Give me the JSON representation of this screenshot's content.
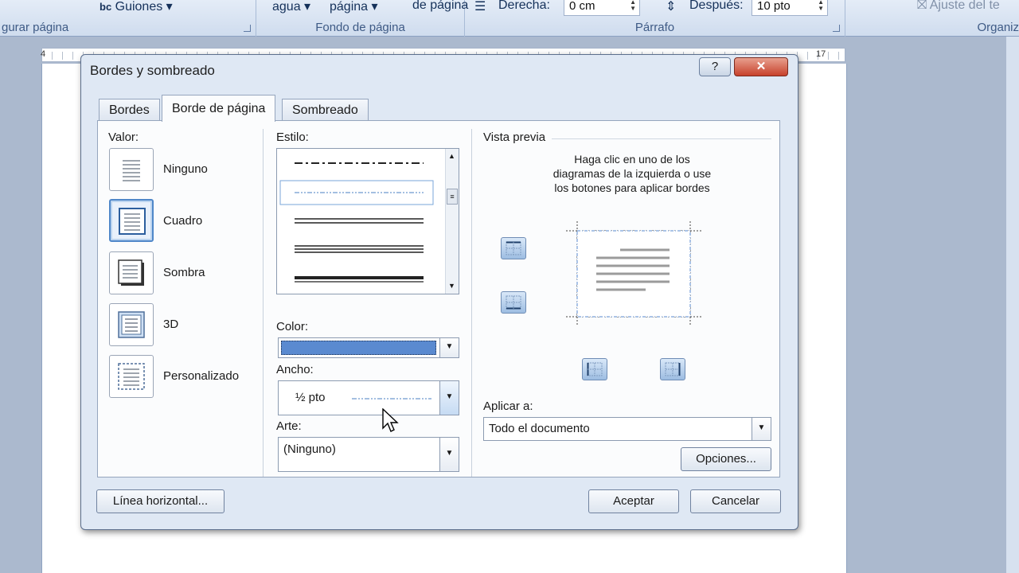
{
  "ribbon": {
    "group1_partial_text": "Guiones",
    "group1_label": "gurar página",
    "fondo_items": [
      "agua",
      "página",
      "de página"
    ],
    "fondo_label": "Fondo de página",
    "derecha_label": "Derecha:",
    "derecha_value": "0 cm",
    "despues_label": "Después:",
    "despues_value": "10 pto",
    "parrafo_label": "Párrafo",
    "ajuste_label": "Ajuste del te",
    "organizar_label": "Organiz"
  },
  "ruler": {
    "numbers": [
      "4",
      "17"
    ]
  },
  "dialog": {
    "title": "Bordes y sombreado",
    "help_label": "?",
    "close_label": "✕",
    "tabs": [
      "Bordes",
      "Borde de página",
      "Sombreado"
    ],
    "active_tab": "Borde de página",
    "valor_label": "Valor:",
    "settings": [
      "Ninguno",
      "Cuadro",
      "Sombra",
      "3D",
      "Personalizado"
    ],
    "selected_setting": "Cuadro",
    "estilo_label": "Estilo:",
    "color_label": "Color:",
    "color_value": "#5a8ad0",
    "ancho_label": "Ancho:",
    "ancho_value": "½ pto",
    "arte_label": "Arte:",
    "arte_value": "(Ninguno)",
    "vista_previa_label": "Vista previa",
    "preview_instructions": [
      "Haga clic en uno de los",
      "diagramas de la izquierda o use",
      "los botones para aplicar bordes"
    ],
    "aplicar_label": "Aplicar a:",
    "aplicar_value": "Todo el documento",
    "opciones_button": "Opciones...",
    "linea_button": "Línea horizontal...",
    "aceptar_button": "Aceptar",
    "cancelar_button": "Cancelar"
  }
}
